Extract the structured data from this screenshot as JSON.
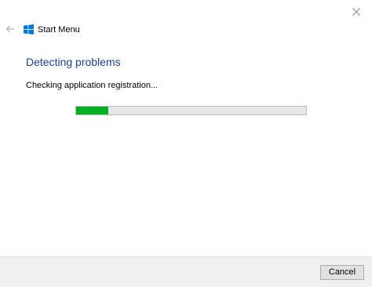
{
  "window": {
    "close_icon": "close-icon"
  },
  "header": {
    "back_icon": "back-arrow-icon",
    "app_icon": "windows-logo-icon",
    "title": "Start Menu"
  },
  "main": {
    "heading": "Detecting problems",
    "status": "Checking application registration...",
    "progress_fraction": 0.14
  },
  "footer": {
    "cancel_label": "Cancel"
  },
  "colors": {
    "heading": "#1e3f96",
    "progress_fill": "#06b025",
    "progress_track": "#e6e6e6",
    "windows_logo": "#0078d7"
  }
}
